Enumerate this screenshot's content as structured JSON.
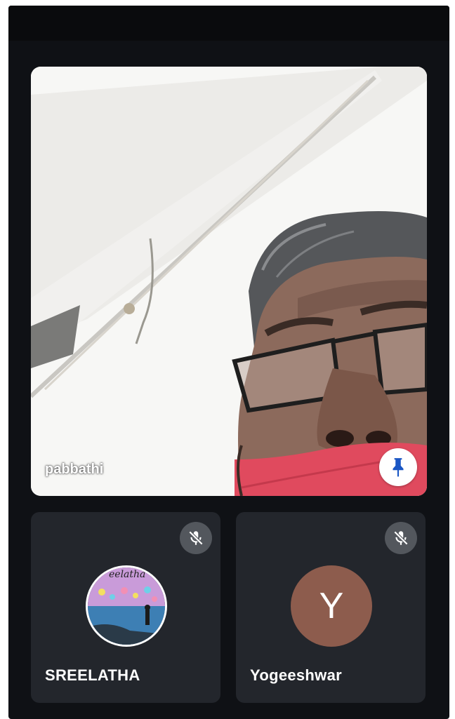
{
  "main_participant": {
    "name": "pabbathi",
    "pin_icon": "pin-icon"
  },
  "participants": [
    {
      "name": "SREELATHA",
      "avatar_type": "photo",
      "avatar_photo_text": "eelatha",
      "mic_icon": "mic-off-icon"
    },
    {
      "name": "Yogeeshwar",
      "avatar_type": "letter",
      "avatar_letter": "Y",
      "avatar_color": "#8d5c4d",
      "mic_icon": "mic-off-icon"
    }
  ],
  "colors": {
    "background": "#0f1115",
    "tile": "#23262c",
    "mute_button": "#53575d",
    "pin_icon": "#1a56c4"
  }
}
